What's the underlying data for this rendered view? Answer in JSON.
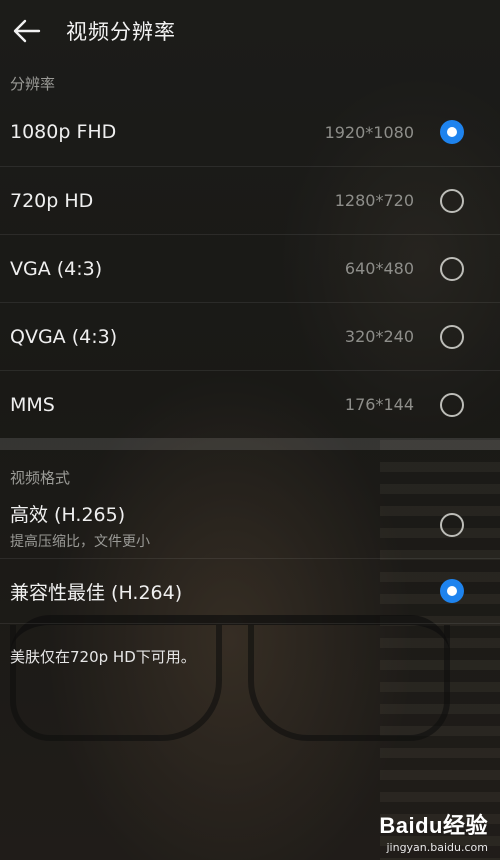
{
  "header": {
    "back_icon": "arrow-left-icon",
    "title": "视频分辨率"
  },
  "resolution_section": {
    "label": "分辨率",
    "options": [
      {
        "name": "1080p FHD",
        "resolution": "1920*1080",
        "selected": true
      },
      {
        "name": "720p HD",
        "resolution": "1280*720",
        "selected": false
      },
      {
        "name": "VGA (4:3)",
        "resolution": "640*480",
        "selected": false
      },
      {
        "name": "QVGA (4:3)",
        "resolution": "320*240",
        "selected": false
      },
      {
        "name": "MMS",
        "resolution": "176*144",
        "selected": false
      }
    ]
  },
  "format_section": {
    "label": "视频格式",
    "options": [
      {
        "name": "高效 (H.265)",
        "subtitle": "提高压缩比，文件更小",
        "selected": false
      },
      {
        "name": "兼容性最佳 (H.264)",
        "selected": true
      }
    ],
    "note": "美肤仅在720p HD下可用。"
  },
  "watermark": {
    "brand": "Baidu经验",
    "url": "jingyan.baidu.com"
  },
  "colors": {
    "accent": "#1e83ee"
  }
}
